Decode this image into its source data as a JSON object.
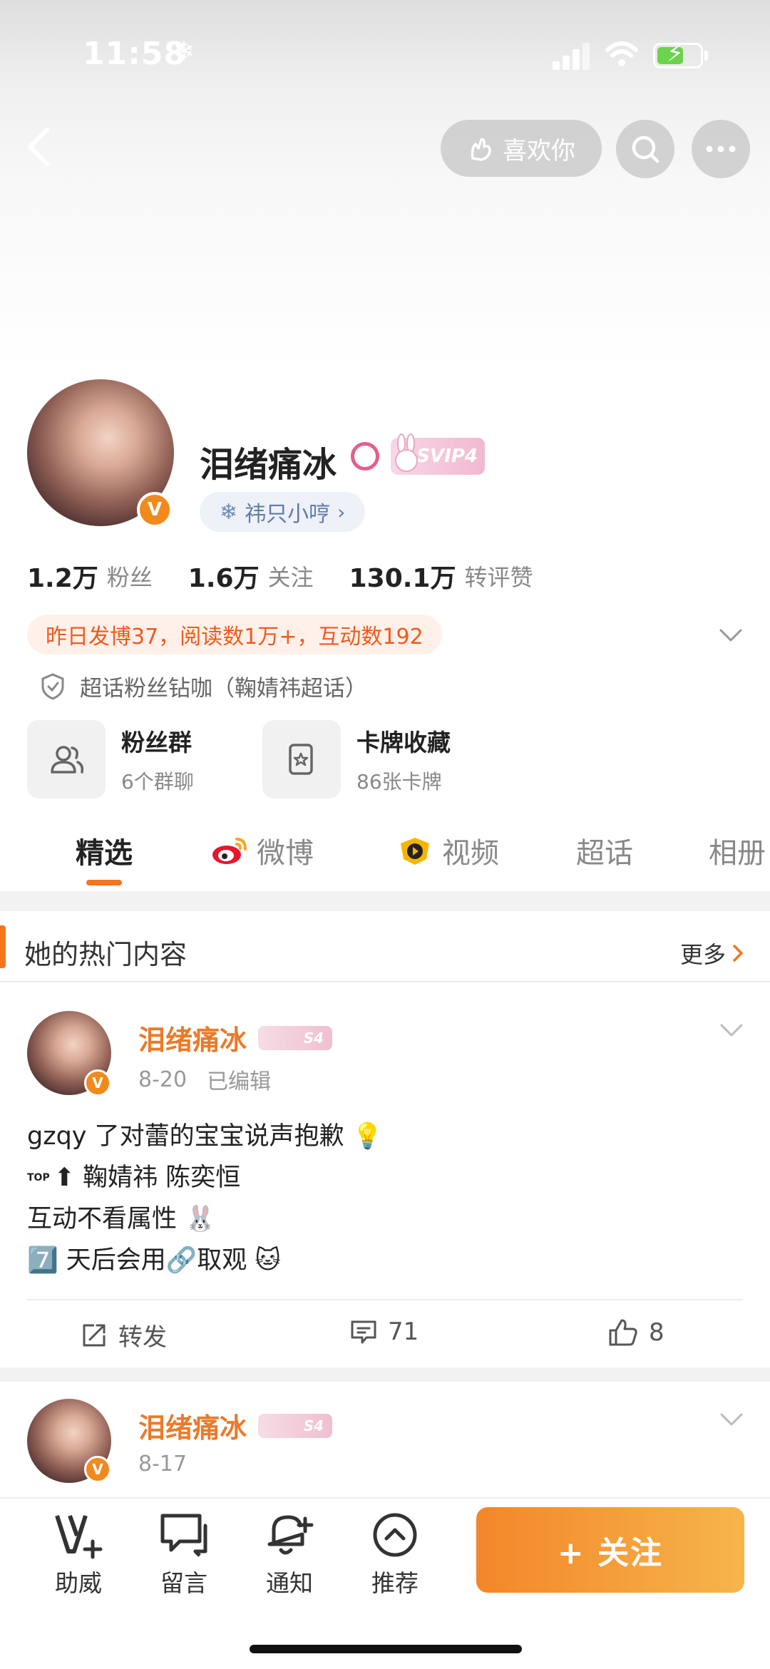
{
  "status_bar": {
    "time": "11:58",
    "time_icon": "snowflake-icon"
  },
  "nav": {
    "like_label": "喜欢你"
  },
  "profile": {
    "name": "泪绪痛冰",
    "svip_badge": "SVIP4",
    "verified_mark": "V",
    "super_tag": "祎只小哼",
    "stats": [
      {
        "value": "1.2万",
        "label": "粉丝"
      },
      {
        "value": "1.6万",
        "label": "关注"
      },
      {
        "value": "130.1万",
        "label": "转评赞"
      }
    ],
    "yesterday_hint": "昨日发博37，阅读数1万+，互动数192",
    "chaohua_line": "超话粉丝钻咖（鞠婧祎超话）",
    "cards": [
      {
        "title": "粉丝群",
        "subtitle": "6个群聊",
        "icon": "group-icon"
      },
      {
        "title": "卡牌收藏",
        "subtitle": "86张卡牌",
        "icon": "card-icon"
      }
    ]
  },
  "tabs": [
    "精选",
    "微博",
    "视频",
    "超话",
    "相册"
  ],
  "hot_section": {
    "title": "她的热门内容",
    "more_label": "更多"
  },
  "posts": [
    {
      "author": "泪绪痛冰",
      "badge": "S4",
      "date": "8-20",
      "edited": "已编辑",
      "lines": [
        "gzqy 了对蕾的宝宝说声抱歉 💡",
        "⬆ 鞠婧祎 陈奕恒",
        "互动不看属性 🐰",
        "7️⃣ 天后会用🔗取观 🐱"
      ],
      "line_prefixes": [
        "",
        "TOP",
        "",
        ""
      ],
      "actions": {
        "repost": "转发",
        "comments": "71",
        "likes": "8"
      }
    },
    {
      "author": "泪绪痛冰",
      "badge": "S4",
      "date": "8-17"
    }
  ],
  "bottom_bar": {
    "items": [
      {
        "label": "助威",
        "icon": "v-plus-icon"
      },
      {
        "label": "留言",
        "icon": "message-icon"
      },
      {
        "label": "通知",
        "icon": "bell-plus-icon"
      },
      {
        "label": "推荐",
        "icon": "chevron-up-circle-icon"
      }
    ],
    "follow_label": "+ 关注"
  },
  "colors": {
    "accent": "#f5741e",
    "name_orange": "#eb7a2a",
    "hint_text": "#f05a1e",
    "verified": "#f08a1c"
  }
}
